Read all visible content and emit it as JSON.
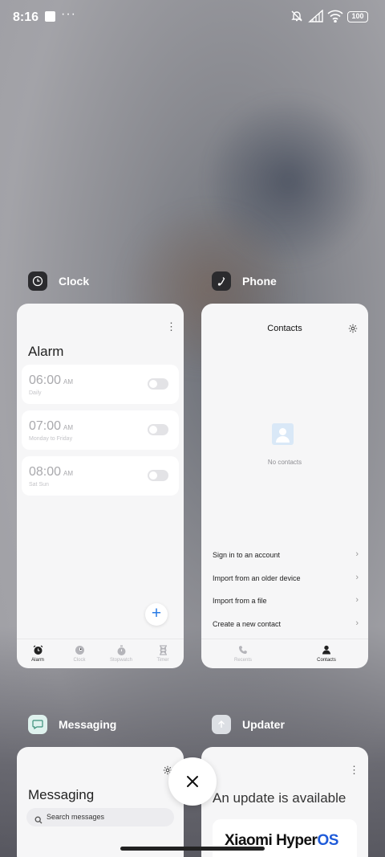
{
  "status_bar": {
    "time": "8:16",
    "more": "···",
    "battery": "100"
  },
  "clock_app": {
    "name": "Clock",
    "screen_title": "Alarm",
    "alarms": [
      {
        "time": "06:00",
        "ampm": "AM",
        "repeat": "Daily"
      },
      {
        "time": "07:00",
        "ampm": "AM",
        "repeat": "Monday to Friday"
      },
      {
        "time": "08:00",
        "ampm": "AM",
        "repeat": "Sat Sun"
      }
    ],
    "add_label": "+",
    "tabs": [
      {
        "label": "Alarm",
        "icon": "alarm-icon"
      },
      {
        "label": "Clock",
        "icon": "clock-icon"
      },
      {
        "label": "Stopwatch",
        "icon": "stopwatch-icon"
      },
      {
        "label": "Timer",
        "icon": "timer-icon"
      }
    ]
  },
  "phone_app": {
    "name": "Phone",
    "screen_title": "Contacts",
    "empty_text": "No contacts",
    "options": [
      "Sign in to an account",
      "Import from an older device",
      "Import from a file",
      "Create a new contact"
    ],
    "tabs": [
      {
        "label": "Recents",
        "icon": "phone-icon"
      },
      {
        "label": "Contacts",
        "icon": "person-icon"
      }
    ]
  },
  "messaging_app": {
    "name": "Messaging",
    "screen_title": "Messaging",
    "search_placeholder": "Search messages"
  },
  "updater_app": {
    "name": "Updater",
    "headline": "An update is available",
    "brand_prefix": "Xiaomi Hyper",
    "brand_suffix": "OS"
  },
  "colors": {
    "accent": "#2a7be4",
    "brand_os": "#1f5bd9"
  }
}
